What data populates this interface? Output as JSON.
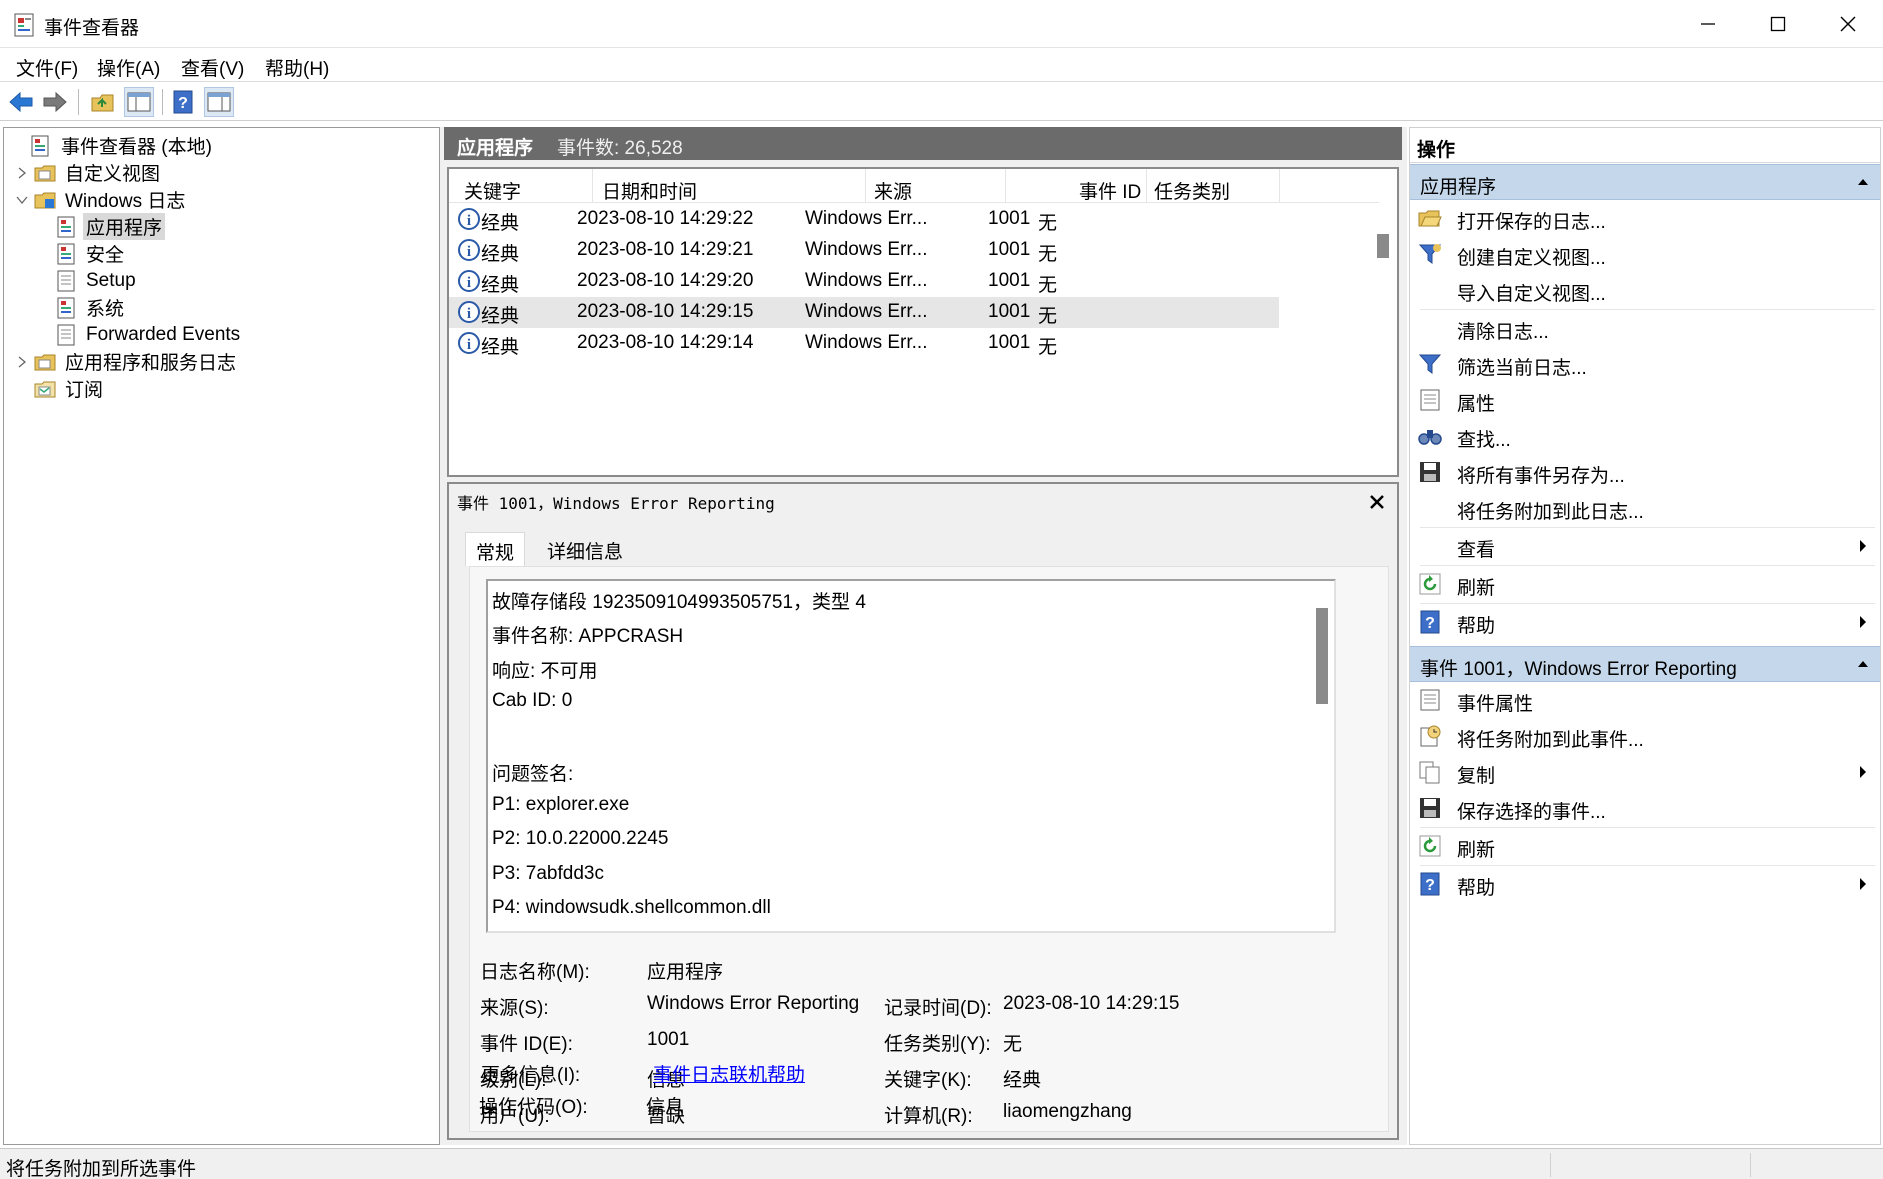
{
  "window": {
    "title": "事件查看器"
  },
  "menu": [
    "文件(F)",
    "操作(A)",
    "查看(V)",
    "帮助(H)"
  ],
  "tree": [
    {
      "label": "事件查看器 (本地)",
      "arrow": "",
      "icon": "eventviewer",
      "level": 0
    },
    {
      "label": "自定义视图",
      "arrow": "right",
      "icon": "folder",
      "level": 1
    },
    {
      "label": "Windows 日志",
      "arrow": "down",
      "icon": "folder-win",
      "level": 1
    },
    {
      "label": "应用程序",
      "arrow": "",
      "icon": "log",
      "level": 2,
      "selected": true
    },
    {
      "label": "安全",
      "arrow": "",
      "icon": "log",
      "level": 2
    },
    {
      "label": "Setup",
      "arrow": "",
      "icon": "log-plain",
      "level": 2
    },
    {
      "label": "系统",
      "arrow": "",
      "icon": "log",
      "level": 2
    },
    {
      "label": "Forwarded Events",
      "arrow": "",
      "icon": "log-plain",
      "level": 2
    },
    {
      "label": "应用程序和服务日志",
      "arrow": "right",
      "icon": "folder",
      "level": 1
    },
    {
      "label": "订阅",
      "arrow": "",
      "icon": "subscribe",
      "level": 1
    }
  ],
  "center": {
    "title": "应用程序",
    "count_label": "事件数: 26,528"
  },
  "grid": {
    "columns": [
      "关键字",
      "日期和时间",
      "来源",
      "事件 ID",
      "任务类别"
    ],
    "rows": [
      {
        "keyword": "经典",
        "datetime": "2023-08-10 14:29:22",
        "source": "Windows Err...",
        "id": "1001",
        "task": "无"
      },
      {
        "keyword": "经典",
        "datetime": "2023-08-10 14:29:21",
        "source": "Windows Err...",
        "id": "1001",
        "task": "无"
      },
      {
        "keyword": "经典",
        "datetime": "2023-08-10 14:29:20",
        "source": "Windows Err...",
        "id": "1001",
        "task": "无"
      },
      {
        "keyword": "经典",
        "datetime": "2023-08-10 14:29:15",
        "source": "Windows Err...",
        "id": "1001",
        "task": "无",
        "selected": true
      },
      {
        "keyword": "经典",
        "datetime": "2023-08-10 14:29:14",
        "source": "Windows Err...",
        "id": "1001",
        "task": "无"
      }
    ]
  },
  "detail": {
    "title": "事件 1001，Windows Error Reporting",
    "tabs": [
      "常规",
      "详细信息"
    ],
    "description": [
      "故障存储段 1923509104993505751，类型 4",
      "事件名称: APPCRASH",
      "响应: 不可用",
      "Cab ID: 0",
      "",
      "问题签名:",
      "P1: explorer.exe",
      "P2: 10.0.22000.2245",
      "P3: 7abfdd3c",
      "P4: windowsudk.shellcommon.dll"
    ],
    "props": {
      "log_name_label": "日志名称(M):",
      "log_name": "应用程序",
      "source_label": "来源(S):",
      "source": "Windows Error Reporting",
      "logged_label": "记录时间(D):",
      "logged": "2023-08-10 14:29:15",
      "event_id_label": "事件 ID(E):",
      "event_id": "1001",
      "task_label": "任务类别(Y):",
      "task": "无",
      "level_label": "级别(L):",
      "level": "信息",
      "keywords_label": "关键字(K):",
      "keywords": "经典",
      "user_label": "用户(U):",
      "user": "暂缺",
      "computer_label": "计算机(R):",
      "computer": "liaomengzhang",
      "opcode_label": "操作代码(O):",
      "opcode": "信息",
      "more_info_label": "更多信息(I):",
      "more_info_link": "事件日志联机帮助"
    }
  },
  "actions": {
    "header": "操作",
    "section1": {
      "title": "应用程序",
      "items": [
        {
          "label": "打开保存的日志...",
          "icon": "open-folder-icon"
        },
        {
          "label": "创建自定义视图...",
          "icon": "filter-create-icon"
        },
        {
          "label": "导入自定义视图...",
          "icon": ""
        },
        {
          "label": "清除日志...",
          "icon": ""
        },
        {
          "label": "筛选当前日志...",
          "icon": "filter-icon"
        },
        {
          "label": "属性",
          "icon": "properties-icon"
        },
        {
          "label": "查找...",
          "icon": "binoculars-icon"
        },
        {
          "label": "将所有事件另存为...",
          "icon": "save-icon"
        },
        {
          "label": "将任务附加到此日志...",
          "icon": ""
        },
        {
          "label": "查看",
          "icon": "",
          "submenu": true
        },
        {
          "label": "刷新",
          "icon": "refresh-icon"
        },
        {
          "label": "帮助",
          "icon": "help-icon",
          "submenu": true
        }
      ]
    },
    "section2": {
      "title": "事件 1001，Windows Error Reporting",
      "items": [
        {
          "label": "事件属性",
          "icon": "properties-icon"
        },
        {
          "label": "将任务附加到此事件...",
          "icon": "task-icon"
        },
        {
          "label": "复制",
          "icon": "copy-icon",
          "submenu": true
        },
        {
          "label": "保存选择的事件...",
          "icon": "save-icon"
        },
        {
          "label": "刷新",
          "icon": "refresh-icon"
        },
        {
          "label": "帮助",
          "icon": "help-icon",
          "submenu": true
        }
      ]
    }
  },
  "status": {
    "text": "将任务附加到所选事件"
  }
}
